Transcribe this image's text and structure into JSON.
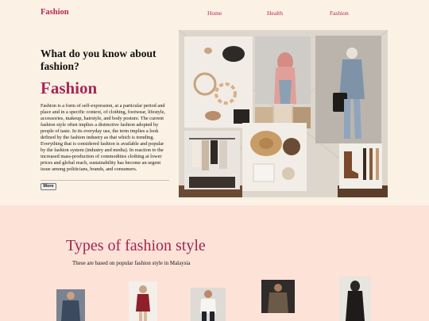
{
  "header": {
    "brand": "Fashion",
    "nav": [
      "Home",
      "Health",
      "Fashion"
    ]
  },
  "hero": {
    "question": "What do you know about fashion?",
    "title": "Fashion",
    "body": "Fashion is a form of self-expression, at a particular period and place and in a specific context, of clothing, footwear, lifestyle, accessories, makeup, hairstyle, and body posture. The current fashion style often implies a distinctive fashion adopted by people of taste. In its everyday use, the term implies a look defined by the fashion industry as that which is trending. Everything that is considered fashion is available and popular by the fashion system (industry and media). In reaction to the increased mass-production of commodities clothing at lower prices and global reach, sustainability has become an urgent issue among politicians, brands, and consumers.",
    "more_label": "More"
  },
  "types": {
    "title": "Types of fashion style",
    "subtitle": "These are based on popular fashion style in Malaysia"
  },
  "colors": {
    "accent": "#a82758",
    "page_bg": "#fbf1e4",
    "section_bg": "#fde2d8"
  }
}
